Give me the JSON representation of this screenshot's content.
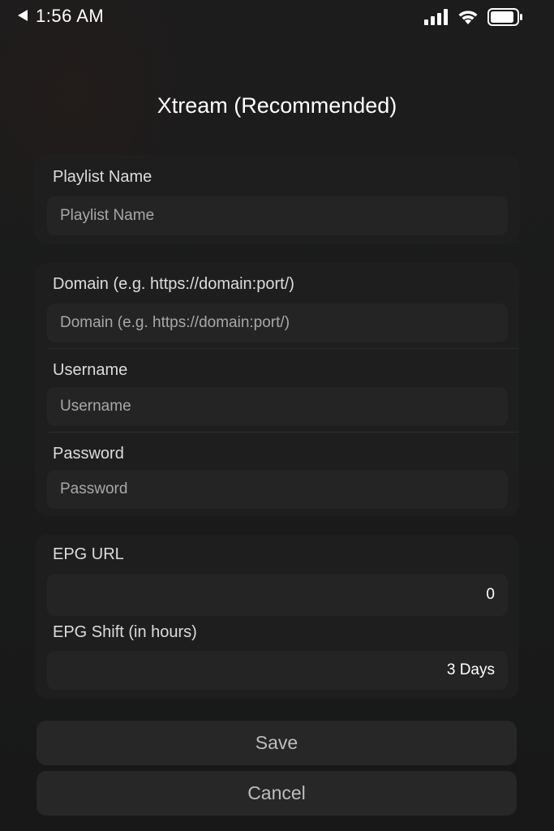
{
  "status_bar": {
    "time": "1:56 AM",
    "icons": [
      "back-arrow-icon",
      "signal-icon",
      "wifi-icon",
      "battery-icon"
    ]
  },
  "page": {
    "title": "Xtream (Recommended)"
  },
  "playlist_section": {
    "name_label": "Playlist Name",
    "name_placeholder": "Playlist Name",
    "name_value": ""
  },
  "credentials_section": {
    "domain_label": "Domain (e.g. https://domain:port/)",
    "domain_placeholder": "Domain (e.g. https://domain:port/)",
    "domain_value": "",
    "username_label": "Username",
    "username_placeholder": "Username",
    "username_value": "",
    "password_label": "Password",
    "password_placeholder": "Password",
    "password_value": ""
  },
  "epg_section": {
    "url_label": "EPG URL",
    "url_value": "0",
    "shift_label": "EPG Shift (in hours)",
    "shift_value": "3 Days"
  },
  "actions": {
    "save_label": "Save",
    "cancel_label": "Cancel"
  },
  "colors": {
    "background": "#1a1a1b",
    "card": "#1e1e1f",
    "field": "#242425",
    "button": "#272727",
    "button_text": "#bdbdbd"
  }
}
